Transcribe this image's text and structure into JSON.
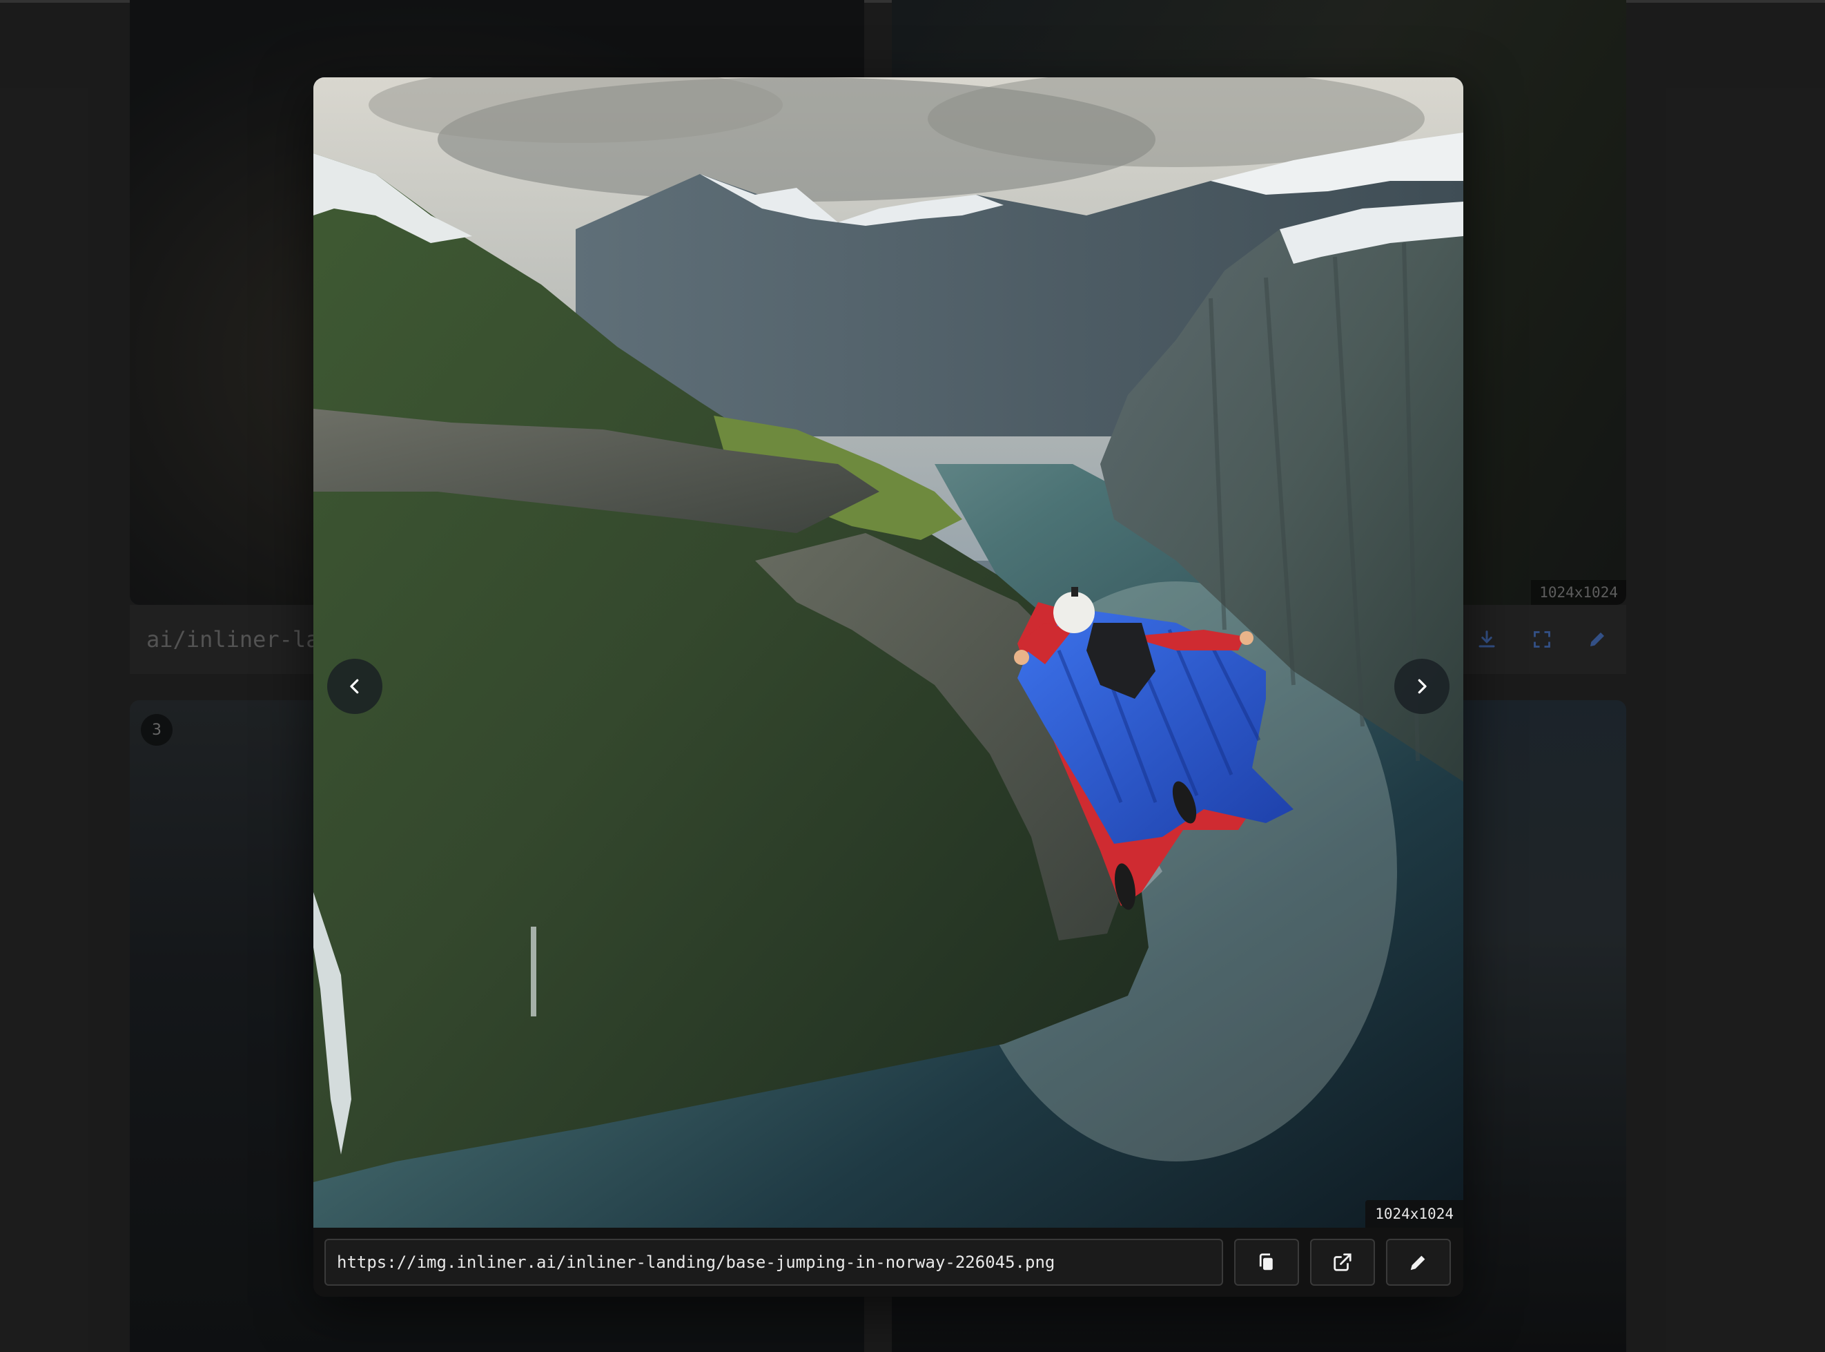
{
  "gallery": {
    "tiles": [
      {
        "dimensions": ""
      },
      {
        "dimensions": "1024x1024"
      },
      {
        "index": "3"
      },
      {}
    ],
    "row_url_fragment": "ai/inliner-la",
    "row_tool_icons": [
      "download-icon",
      "fullscreen-icon",
      "edit-icon"
    ]
  },
  "modal": {
    "image_dimensions": "1024x1024",
    "image_subject": "wingsuit flyer over a Norwegian fjord",
    "url_value": "https://img.inliner.ai/inliner-landing/base-jumping-in-norway-226045.png",
    "nav": {
      "prev_icon": "chevron-left-icon",
      "next_icon": "chevron-right-icon"
    },
    "actions": [
      {
        "name": "copy-button",
        "icon": "copy-icon"
      },
      {
        "name": "open-external-button",
        "icon": "external-link-icon"
      },
      {
        "name": "edit-button",
        "icon": "pencil-icon"
      }
    ]
  },
  "colors": {
    "page_background": "#262626",
    "toolbar_background": "#121212",
    "input_border": "#3a3a3a",
    "wingsuit_blue": "#2f5fd8",
    "wingsuit_red": "#d12a2f"
  }
}
